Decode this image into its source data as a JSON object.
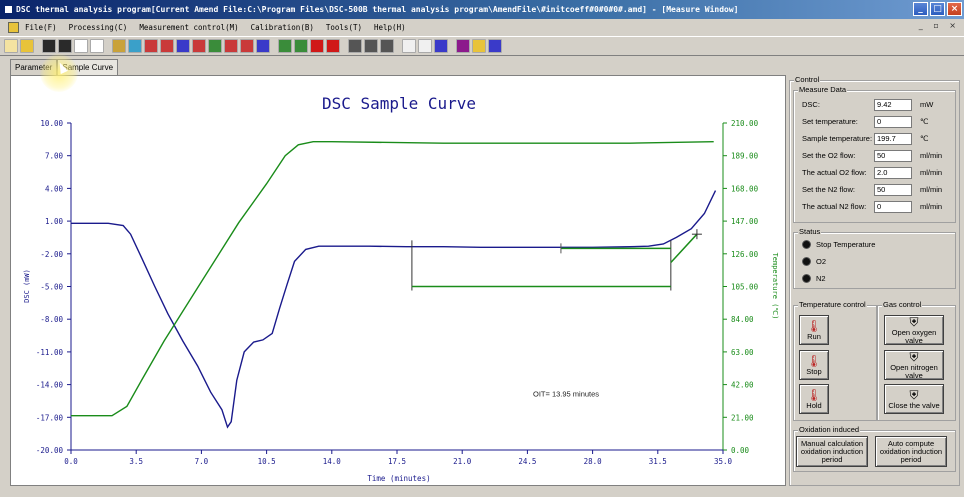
{
  "window": {
    "title": "DSC thermal analysis program[Current Amend File:C:\\Program Files\\DSC-500B thermal analysis program\\AmendFile\\#initcoeff#0#0#0#.amd] - [Measure Window]",
    "minimize": "_",
    "maximize": "□",
    "close": "×",
    "mdi_controls": "_ ▫ ×"
  },
  "menu": {
    "items": [
      "File(F)",
      "Processing(C)",
      "Measurement control(M)",
      "Calibration(B)",
      "Tools(T)",
      "Help(H)"
    ]
  },
  "toolbar": {
    "buttons": [
      "new",
      "open",
      "save",
      "save-all",
      "print-preview",
      "print",
      "zoom-in",
      "edit",
      "mark",
      "peak",
      "baseline",
      "area",
      "onset",
      "endset",
      "tg",
      "ratio",
      "temp",
      "curve",
      "stop",
      "record",
      "export",
      "report",
      "text",
      "cursor",
      "table",
      "compare",
      "graph",
      "help",
      "about"
    ]
  },
  "tabs": [
    "Parameter",
    "Sample Curve"
  ],
  "chart": {
    "title": "DSC Sample Curve",
    "ylabel_left": "DSC (mW)",
    "ylabel_right": "Temperature (℃)",
    "xlabel": "Time (minutes)",
    "annotation": "OIT= 13.95 minutes"
  },
  "chart_data": {
    "type": "line",
    "title": "DSC Sample Curve",
    "xlabel": "Time (minutes)",
    "ylabel": "DSC (mW)",
    "y2label": "Temperature (℃)",
    "xlim": [
      0,
      35
    ],
    "ylim": [
      -20,
      10
    ],
    "y2lim": [
      0,
      210
    ],
    "x_ticks": [
      "0.0",
      "3.5",
      "7.0",
      "10.5",
      "14.0",
      "17.5",
      "21.0",
      "24.5",
      "28.0",
      "31.5",
      "35.0"
    ],
    "y_ticks": [
      "10.00",
      "7.00",
      "4.00",
      "1.00",
      "-2.00",
      "-5.00",
      "-8.00",
      "-11.00",
      "-14.00",
      "-17.00",
      "-20.00"
    ],
    "y2_ticks": [
      "210.00",
      "189.00",
      "168.00",
      "147.00",
      "126.00",
      "105.00",
      "84.00",
      "63.00",
      "42.00",
      "21.00",
      "0.00"
    ],
    "grid": false,
    "series": [
      {
        "axis": "left",
        "color": "#1a1a8c",
        "x": [
          0,
          1,
          2,
          2.8,
          3.2,
          3.8,
          4.5,
          5.2,
          6,
          6.8,
          7.5,
          8.1,
          8.4,
          8.6,
          8.9,
          9.3,
          9.8,
          10.3,
          10.8,
          11.2,
          11.6,
          12,
          12.6,
          13.3,
          14,
          16,
          18,
          20,
          22,
          24,
          26,
          28,
          30,
          31,
          31.8,
          32.5,
          33.3,
          34,
          34.6
        ],
        "y": [
          0.8,
          0.8,
          0.8,
          0.6,
          -0.2,
          -2.4,
          -5.0,
          -7.5,
          -10.0,
          -12.3,
          -14.7,
          -16.3,
          -17.9,
          -17.4,
          -13.6,
          -11.0,
          -10.1,
          -9.9,
          -9.3,
          -7.0,
          -4.8,
          -2.7,
          -1.6,
          -1.3,
          -1.3,
          -1.3,
          -1.35,
          -1.35,
          -1.4,
          -1.4,
          -1.4,
          -1.4,
          -1.35,
          -1.3,
          -1.1,
          -0.5,
          0.3,
          1.7,
          3.8
        ]
      },
      {
        "axis": "right",
        "color": "#1a8c1a",
        "x": [
          0,
          2.2,
          3,
          3.8,
          5,
          7,
          9,
          10.5,
          11.5,
          12.2,
          13,
          14,
          20,
          26,
          30,
          34.5
        ],
        "y": [
          22,
          22,
          28,
          45,
          70,
          108,
          146,
          171,
          189,
          196,
          198,
          198,
          197,
          197,
          197,
          198
        ]
      }
    ],
    "annotations": [
      {
        "text": "OIT= 13.95 minutes",
        "x": 24.8,
        "y": -15.1
      }
    ],
    "oit_markers": {
      "start": 18.3,
      "end": 32.2,
      "baseline_y": -1.5,
      "bracket_y": -5.0,
      "tangent_from": [
        32.2,
        -2.8
      ],
      "tangent_to": [
        33.6,
        -0.2
      ]
    }
  },
  "control": {
    "title": "Control",
    "measure_title": "Measure Data",
    "fields": [
      {
        "label": "DSC:",
        "value": "9.42",
        "unit": "mW"
      },
      {
        "label": "Set temperature:",
        "value": "0",
        "unit": "℃"
      },
      {
        "label": "Sample temperature:",
        "value": "199.7",
        "unit": "℃"
      },
      {
        "label": "Set the O2 flow:",
        "value": "50",
        "unit": "ml/min"
      },
      {
        "label": "The actual O2 flow:",
        "value": "2.0",
        "unit": "ml/min"
      },
      {
        "label": "Set the N2 flow:",
        "value": "50",
        "unit": "ml/min"
      },
      {
        "label": "The actual N2 flow:",
        "value": "0",
        "unit": "ml/min"
      }
    ],
    "status_title": "Status",
    "status": [
      "Stop Temperature",
      "O2",
      "N2"
    ],
    "temp_control_title": "Temperature control",
    "gas_control_title": "Gas control",
    "temp_buttons": [
      "Run",
      "Stop",
      "Hold"
    ],
    "gas_buttons": [
      "Open oxygen valve",
      "Open nitrogen valve",
      "Close the valve"
    ],
    "oxidation_title": "Oxidation induced",
    "oxidation_buttons": [
      "Manual calculation oxidation induction period",
      "Auto compute oxidation induction period"
    ]
  }
}
